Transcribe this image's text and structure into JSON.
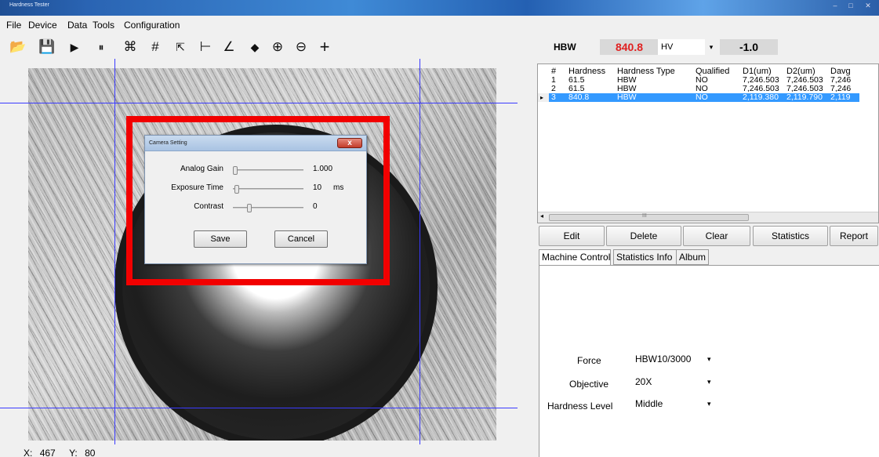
{
  "window": {
    "title": "Hardness Tester",
    "controls": [
      "–",
      "□",
      "✕"
    ]
  },
  "menu": [
    "File",
    "Device",
    "Data",
    "Tools",
    "Configuration"
  ],
  "toolbar": [
    {
      "name": "open-folder-icon",
      "glyph": "📂"
    },
    {
      "name": "save-icon",
      "glyph": "💾"
    },
    {
      "name": "play-icon",
      "glyph": "▶"
    },
    {
      "name": "pause-icon",
      "glyph": "⏸"
    },
    {
      "name": "auto-measure-icon",
      "glyph": "⌘"
    },
    {
      "name": "grid-icon",
      "glyph": "#"
    },
    {
      "name": "select-arrow-icon",
      "glyph": "⇱"
    },
    {
      "name": "line-measure-icon",
      "glyph": "⊢"
    },
    {
      "name": "angle-icon",
      "glyph": "∠"
    },
    {
      "name": "eraser-icon",
      "glyph": "◆"
    },
    {
      "name": "zoom-in-icon",
      "glyph": "⊕"
    },
    {
      "name": "zoom-out-icon",
      "glyph": "⊖"
    },
    {
      "name": "crosshair-icon",
      "glyph": "+"
    }
  ],
  "camera_dialog": {
    "title": "Camera Setting",
    "close": "x",
    "rows": [
      {
        "label": "Analog Gain",
        "value": "1.000",
        "unit": "",
        "level": 0.0
      },
      {
        "label": "Exposure Time",
        "value": "10",
        "unit": "ms",
        "level": 0.02
      },
      {
        "label": "Contrast",
        "value": "0",
        "unit": "",
        "level": 0.2
      }
    ],
    "save": "Save",
    "cancel": "Cancel"
  },
  "coords": {
    "x_label": "X:",
    "x": "467",
    "y_label": "Y:",
    "y": "80"
  },
  "readout": {
    "scale": "HBW",
    "value": "840.8",
    "convert_scale": "HV",
    "convert_value": "-1.0"
  },
  "table": {
    "columns": [
      "#",
      "Hardness",
      "Hardness Type",
      "Qualified",
      "D1(um)",
      "D2(um)",
      "Davg"
    ],
    "rows": [
      [
        "1",
        "61.5",
        "HBW",
        "NO",
        "7,246.503",
        "7,246.503",
        "7,246"
      ],
      [
        "2",
        "61.5",
        "HBW",
        "NO",
        "7,246.503",
        "7,246.503",
        "7,246"
      ],
      [
        "3",
        "840.8",
        "HBW",
        "NO",
        "2,119.380",
        "2,119.790",
        "2,119"
      ]
    ],
    "selected_row": 2,
    "scroll_mark": "III"
  },
  "actions": [
    "Edit",
    "Delete",
    "Clear",
    "Statistics",
    "Report"
  ],
  "tabs": [
    "Machine Control",
    "Statistics Info",
    "Album"
  ],
  "machine_control": {
    "force_label": "Force",
    "force_value": "HBW10/3000",
    "objective_label": "Objective",
    "objective_value": "20X",
    "level_label": "Hardness Level",
    "level_value": "Middle"
  },
  "colors": {
    "accent": "#3399ff",
    "hardness_value": "#e02020",
    "highlight_box": "#f20000",
    "crosshair": "#3a3aff"
  }
}
